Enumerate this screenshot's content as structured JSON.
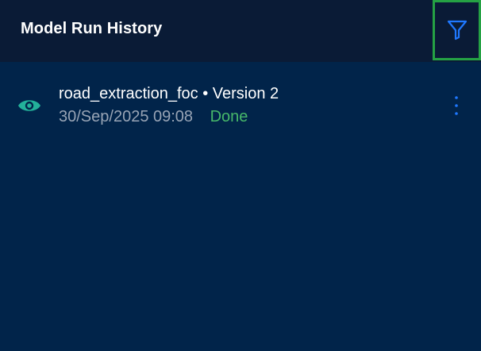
{
  "panel": {
    "title": "Model Run History",
    "filter_icon": "filter-icon"
  },
  "runs": [
    {
      "icon": "eye-icon",
      "name": "road_extraction_foc • Version 2",
      "timestamp": "30/Sep/2025 09:08",
      "status": "Done",
      "menu_icon": "kebab-menu-icon"
    }
  ],
  "colors": {
    "background": "#01244a",
    "header": "#0a1b36",
    "accent": "#1f78ff",
    "eye": "#23b19a",
    "status_done": "#47b86a",
    "focus_outline": "#25a244"
  }
}
